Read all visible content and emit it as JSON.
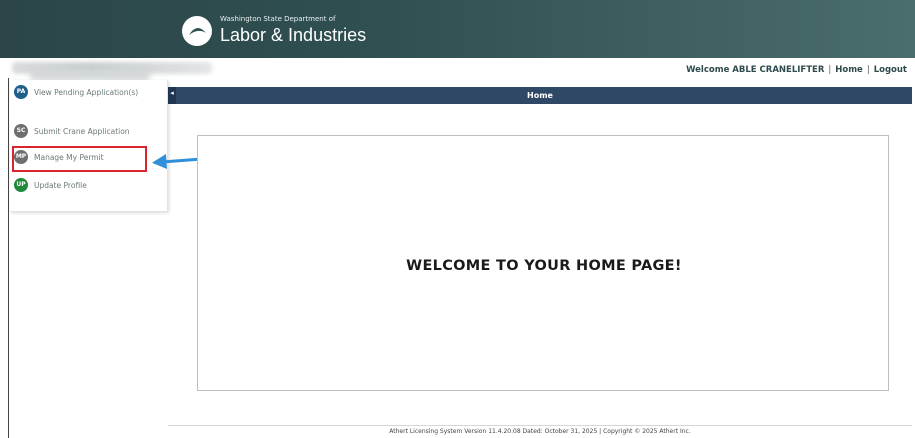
{
  "header": {
    "agency_line1": "Washington State Department of",
    "agency_line2": "Labor & Industries"
  },
  "topnav": {
    "welcome": "Welcome ABLE CRANELIFTER",
    "separator": "|",
    "home": "Home",
    "logout": "Logout"
  },
  "sidebar": {
    "items": [
      {
        "badge": "PA",
        "badge_color": "#1f5f8c",
        "label": "View Pending Application(s)"
      },
      {
        "badge": "SC",
        "badge_color": "#6e6e6e",
        "label": "Submit Crane Application"
      },
      {
        "badge": "MP",
        "badge_color": "#6e6e6e",
        "label": "Manage My Permit"
      },
      {
        "badge": "UP",
        "badge_color": "#1e8a3a",
        "label": "Update Profile"
      }
    ]
  },
  "main": {
    "title": "Home",
    "collapse_glyph": "◂",
    "welcome_text": "WELCOME TO YOUR HOME PAGE!"
  },
  "footer": {
    "text": "Athert Licensing System Version 11.4.20.08 Dated: October 31, 2025 | Copyright © 2025 Athert Inc."
  },
  "annotation": {
    "highlight_color": "#d9262c",
    "arrow_color": "#2f8fd8"
  }
}
